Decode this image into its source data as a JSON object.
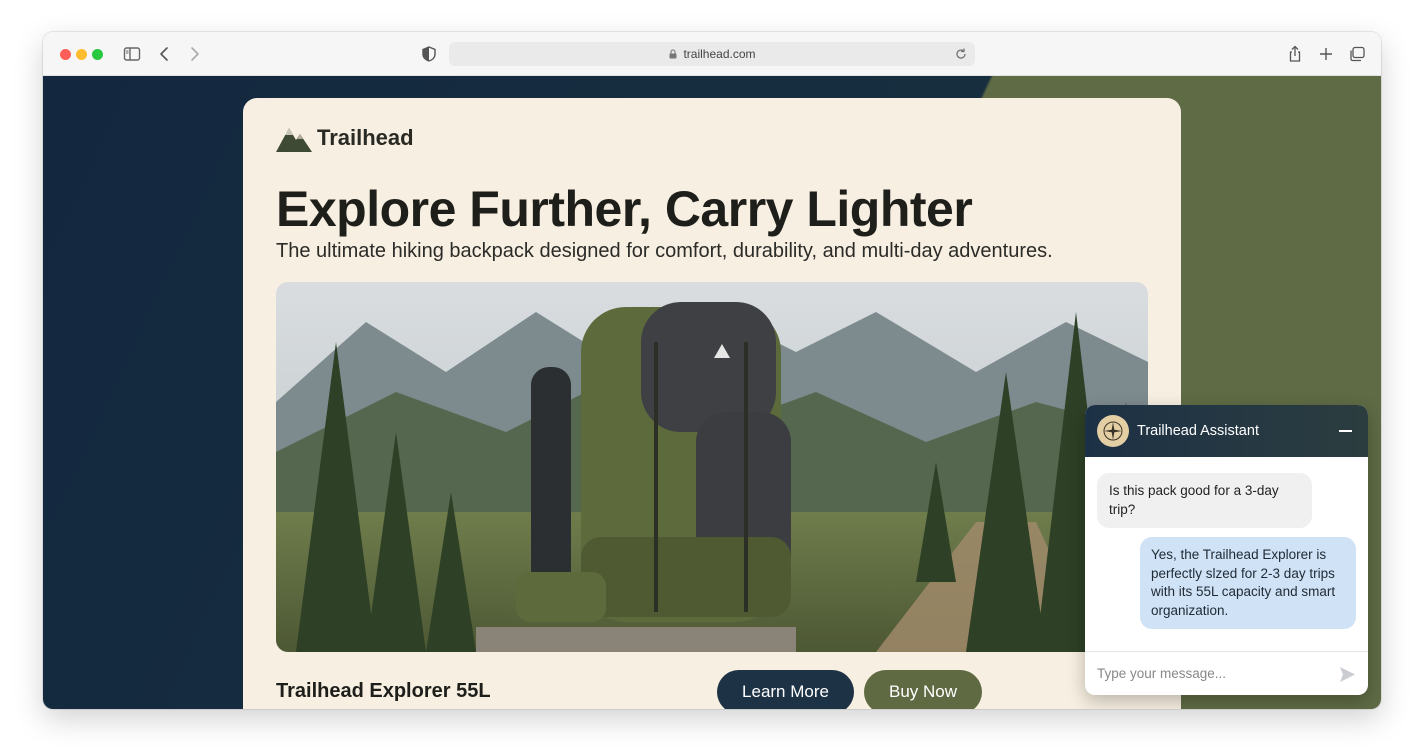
{
  "browser": {
    "url": "trailhead.com"
  },
  "page": {
    "brand": "Trailhead",
    "headline": "Explore Further, Carry Lighter",
    "subhead": "The ultimate hiking backpack designed for comfort, durability, and multi-day adventures.",
    "product_name": "Trailhead Explorer 55L",
    "learn_more": "Learn More",
    "buy_now": "Buy Now"
  },
  "chat": {
    "title": "Trailhead Assistant",
    "messages": [
      {
        "from": "user",
        "text": "Is this pack good for a 3-day trip?"
      },
      {
        "from": "assistant",
        "text": "Yes, the Trailhead Explorer is perfectly slzed for 2-3 day trips with its 55L capacity and smart organization."
      }
    ],
    "input_placeholder": "Type your message..."
  },
  "colors": {
    "navy": "#13283f",
    "olive": "#5f6b45",
    "cream": "#f7efe1",
    "bubble_blue": "#cfe2f6"
  }
}
